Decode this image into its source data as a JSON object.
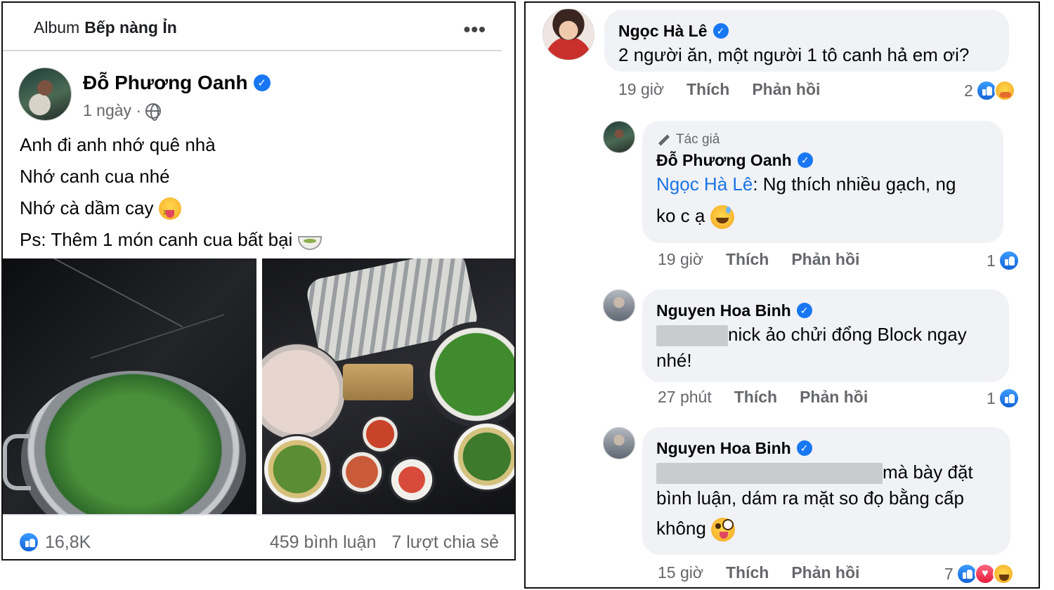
{
  "post": {
    "album_prefix": "Album",
    "album_name": "Bếp nàng Ỉn",
    "more_icon": "more-dots-icon",
    "author": "Đỗ Phương Oanh",
    "time": "1 ngày ·",
    "privacy_icon": "globe-icon",
    "lines": [
      "Anh đi anh nhớ quê nhà",
      "Nhớ canh cua nhé",
      "Nhớ cà dầm cay",
      "Ps: Thêm 1 món canh cua bất bại"
    ],
    "likes": "16,8K",
    "comments": "459 bình luận",
    "shares": "7 lượt chia sẻ"
  },
  "comments": [
    {
      "name": "Ngọc Hà Lê",
      "text": "2 người ăn, một người 1 tô canh hả em ơi?",
      "time": "19 giờ",
      "like_label": "Thích",
      "reply_label": "Phản hồi",
      "reaction_count": "2"
    },
    {
      "author_tag": "Tác giả",
      "name": "Đỗ Phương Oanh",
      "mention": "Ngọc Hà Lê",
      "text_line1": ": Ng thích nhiều gạch, ng",
      "text_line2": "ko c ạ",
      "time": "19 giờ",
      "like_label": "Thích",
      "reply_label": "Phản hồi",
      "reaction_count": "1"
    },
    {
      "name": "Nguyen Hoa Binh",
      "text_line1": "nick ảo chửi đổng Block ngay",
      "text_line2": "nhé!",
      "time": "27 phút",
      "like_label": "Thích",
      "reply_label": "Phản hồi",
      "reaction_count": "1"
    },
    {
      "name": "Nguyen Hoa Binh",
      "text_line1": "mà bày đặt",
      "text_line2": "bình luận, dám ra mặt so đọ bằng cấp",
      "text_line3": "không",
      "time": "15 giờ",
      "like_label": "Thích",
      "reply_label": "Phản hồi",
      "reaction_count": "7"
    }
  ],
  "colors": {
    "facebook_blue": "#1877f2",
    "mention_blue": "#1b74e4",
    "meta_gray": "#65676b",
    "bubble_bg": "#f0f2f5"
  }
}
